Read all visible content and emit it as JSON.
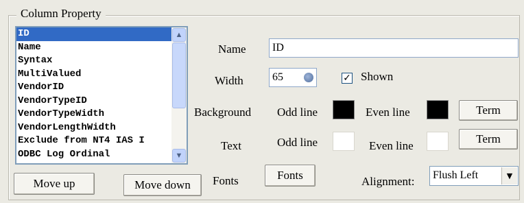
{
  "group_title": "Column Property",
  "list": {
    "items": [
      "ID",
      "Name",
      "Syntax",
      "MultiValued",
      "VendorID",
      "VendorTypeID",
      "VendorTypeWidth",
      "VendorLengthWidth",
      "Exclude from NT4 IAS I",
      "ODBC Log Ordinal"
    ],
    "selected": "ID"
  },
  "buttons": {
    "move_up": "Move up",
    "move_down": "Move down",
    "fonts": "Fonts",
    "term_bg": "Term",
    "term_text": "Term"
  },
  "labels": {
    "name": "Name",
    "width": "Width",
    "shown": "Shown",
    "background": "Background",
    "text": "Text",
    "fonts": "Fonts",
    "odd_line_bg": "Odd line",
    "even_line_bg": "Even line",
    "odd_line_text": "Odd line",
    "even_line_text": "Even line",
    "alignment": "Alignment:"
  },
  "fields": {
    "name_value": "ID",
    "width_value": "65",
    "alignment_value": "Flush Left",
    "shown_checked": true
  },
  "colors": {
    "bg_odd": "#000000",
    "bg_even": "#000000",
    "text_odd": "#ffffff",
    "text_even": "#ffffff",
    "selection": "#316ac5"
  },
  "icons": {
    "scroll_up": "▲",
    "scroll_down": "▼",
    "dropdown": "▼",
    "check": "✓"
  }
}
